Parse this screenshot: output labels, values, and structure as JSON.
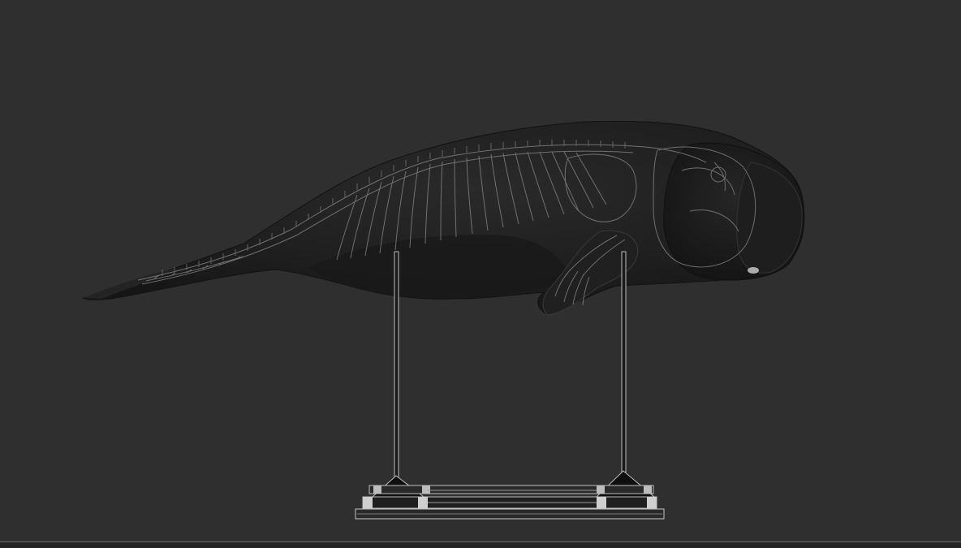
{
  "scene": {
    "subject": "dugong-with-skeleton",
    "stand": "display-stand",
    "colors": {
      "background": "#2f2f2f",
      "body": "#1c1c1c",
      "skeleton_lines": "#8a8a8a",
      "stand_metal": "#bdbdbd",
      "stand_shadow": "#0d0d0d"
    }
  }
}
